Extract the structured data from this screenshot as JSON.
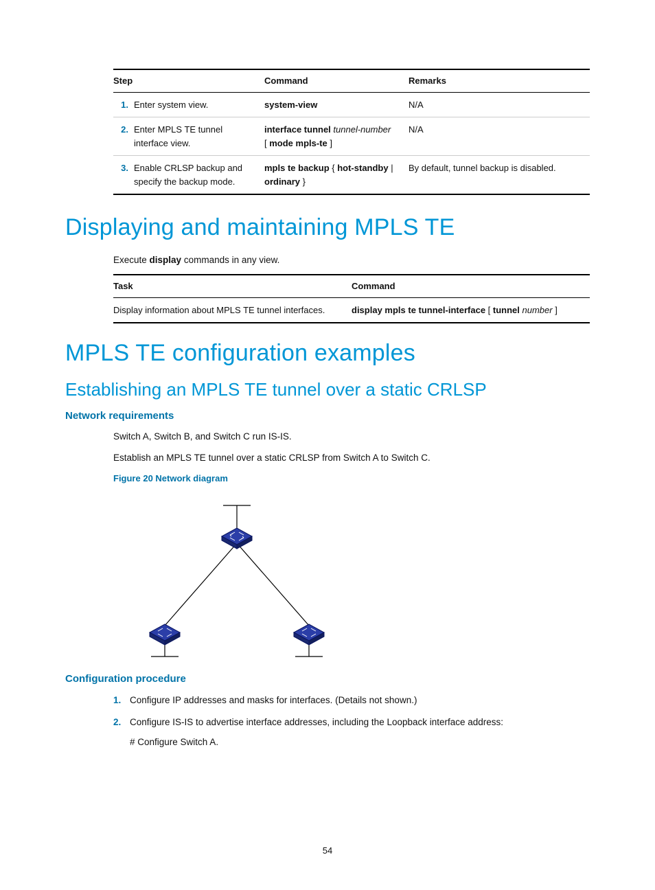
{
  "table1": {
    "headers": [
      "Step",
      "Command",
      "Remarks"
    ],
    "rows": [
      {
        "num": "1.",
        "step": "Enter system view.",
        "cmd_bold": "system-view",
        "cmd_ital": "",
        "cmd_tail": "",
        "remarks": "N/A"
      },
      {
        "num": "2.",
        "step": "Enter MPLS TE tunnel interface view.",
        "cmd_bold": "interface tunnel",
        "cmd_ital": " tunnel-number",
        "cmd_tail": "[ mode mpls-te ]",
        "remarks": "N/A"
      },
      {
        "num": "3.",
        "step": "Enable CRLSP backup and specify the backup mode.",
        "cmd_bold": "mpls te backup",
        "cmd_plain1": " { ",
        "cmd_bold2": "hot-standby",
        "cmd_plain2": " | ",
        "cmd_bold3": "ordinary",
        "cmd_plain3": " }",
        "remarks": "By default, tunnel backup is disabled."
      }
    ]
  },
  "h1a": "Displaying and maintaining MPLS TE",
  "exec_pre": "Execute ",
  "exec_bold": "display",
  "exec_post": " commands in any view.",
  "table2": {
    "headers": [
      "Task",
      "Command"
    ],
    "task": "Display information about MPLS TE tunnel interfaces.",
    "cmd_bold1": "display mpls te tunnel-interface",
    "cmd_plain1": " [ ",
    "cmd_bold2": "tunnel",
    "cmd_ital": " number",
    "cmd_plain2": " ]"
  },
  "h1b": "MPLS TE configuration examples",
  "h2": "Establishing an MPLS TE tunnel over a static CRLSP",
  "h3a": "Network requirements",
  "p1": "Switch A, Switch B, and Switch C run IS-IS.",
  "p2": "Establish an MPLS TE tunnel over a static CRLSP from Switch A to Switch C.",
  "figcap": "Figure 20 Network diagram",
  "h3b": "Configuration procedure",
  "proc": [
    {
      "num": "1.",
      "text": "Configure IP addresses and masks for interfaces. (Details not shown.)"
    },
    {
      "num": "2.",
      "text": "Configure IS-IS to advertise interface addresses, including the Loopback interface address:",
      "sub": "# Configure Switch A."
    }
  ],
  "pagenum": "54"
}
